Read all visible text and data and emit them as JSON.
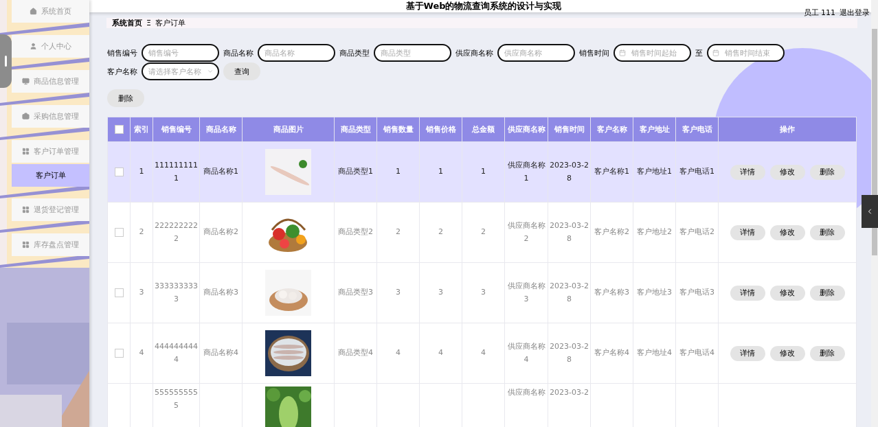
{
  "sidebar": {
    "items": [
      {
        "label": "系统首页",
        "kind": "menu",
        "selected": false
      },
      {
        "label": "个人中心",
        "kind": "menu",
        "selected": false
      },
      {
        "label": "商品信息管理",
        "kind": "menu",
        "selected": false
      },
      {
        "label": "采购信息管理",
        "kind": "menu",
        "selected": false
      },
      {
        "label": "客户订单管理",
        "kind": "menu",
        "selected": false
      },
      {
        "label": "客户订单",
        "kind": "submenu",
        "selected": true
      },
      {
        "label": "退货登记管理",
        "kind": "menu",
        "selected": false
      },
      {
        "label": "库存盘点管理",
        "kind": "menu",
        "selected": false
      }
    ]
  },
  "header": {
    "title": "基于Web的物流查询系统的设计与实现",
    "user": "员工 111",
    "logout": "退出登录"
  },
  "breadcrumb": {
    "items": [
      "系统首页",
      "客户订单"
    ],
    "separator": "Ξ"
  },
  "filters": [
    {
      "label": "销售编号",
      "placeholder": "销售编号",
      "kind": "text"
    },
    {
      "label": "商品名称",
      "placeholder": "商品名称",
      "kind": "text"
    },
    {
      "label": "商品类型",
      "placeholder": "商品类型",
      "kind": "text"
    },
    {
      "label": "供应商名称",
      "placeholder": "供应商名称",
      "kind": "text"
    },
    {
      "label": "销售时间",
      "placeholder": "销售时间起始",
      "kind": "date"
    },
    {
      "label": "至",
      "placeholder": "销售时间结束",
      "kind": "date"
    },
    {
      "label": "客户名称",
      "placeholder": "请选择客户名称",
      "kind": "select"
    }
  ],
  "search_button": "查询",
  "delete_button": "删除",
  "table": {
    "columns": [
      "索引",
      "销售编号",
      "商品名称",
      "商品图片",
      "商品类型",
      "销售数量",
      "销售价格",
      "总金额",
      "供应商名称",
      "销售时间",
      "客户名称",
      "客户地址",
      "客户电话",
      "操作"
    ],
    "header_checked": false,
    "rows": [
      {
        "highlighted": true,
        "checked": false,
        "cells": [
          "1",
          "1111111111",
          "商品名称1",
          "",
          "商品类型1",
          "1",
          "1",
          "1",
          "供应商名称1",
          "2023-03-28",
          "客户名称1",
          "客户地址1",
          "客户电话1"
        ],
        "actions": [
          "详情",
          "修改",
          "删除"
        ]
      },
      {
        "highlighted": false,
        "checked": false,
        "cells": [
          "2",
          "2222222222",
          "商品名称2",
          "",
          "商品类型2",
          "2",
          "2",
          "2",
          "供应商名称2",
          "2023-03-28",
          "客户名称2",
          "客户地址2",
          "客户电话2"
        ],
        "actions": [
          "详情",
          "修改",
          "删除"
        ]
      },
      {
        "highlighted": false,
        "checked": false,
        "cells": [
          "3",
          "3333333333",
          "商品名称3",
          "",
          "商品类型3",
          "3",
          "3",
          "3",
          "供应商名称3",
          "2023-03-28",
          "客户名称3",
          "客户地址3",
          "客户电话3"
        ],
        "actions": [
          "详情",
          "修改",
          "删除"
        ]
      },
      {
        "highlighted": false,
        "checked": false,
        "cells": [
          "4",
          "4444444444",
          "商品名称4",
          "",
          "商品类型4",
          "4",
          "4",
          "4",
          "供应商名称4",
          "2023-03-28",
          "客户名称4",
          "客户地址4",
          "客户电话4"
        ],
        "actions": [
          "详情",
          "修改",
          "删除"
        ]
      },
      {
        "highlighted": false,
        "cells": [
          "",
          "5555555555",
          "",
          "",
          "",
          "",
          "",
          "",
          "供应商名称",
          "2023-03-2",
          "",
          "",
          ""
        ]
      }
    ]
  }
}
